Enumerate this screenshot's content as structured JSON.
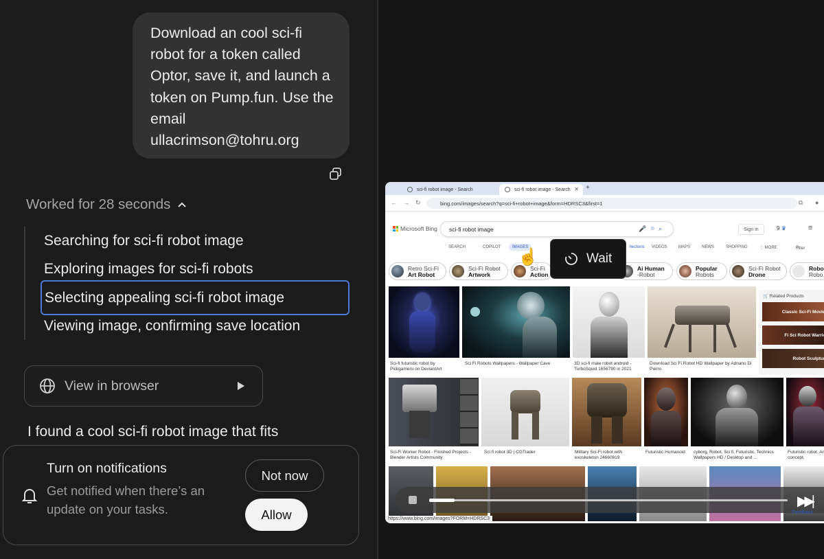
{
  "chat": {
    "user_message": "Download an cool sci-fi robot for a token called Optor, save it, and launch a token on Pump.fun. Use the email ullacrimson@tohru.org",
    "worked_label": "Worked for 28 seconds",
    "steps": [
      "Searching for sci-fi robot image",
      "Exploring images for sci-fi robots",
      "Selecting appealing sci-fi robot image",
      "Viewing image, confirming save location"
    ],
    "view_in_browser": "View in browser",
    "assistant_text": "I found a cool sci-fi robot image that fits"
  },
  "notification": {
    "title": "Turn on notifications",
    "description": "Get notified when there’s an update on your tasks.",
    "not_now": "Not now",
    "allow": "Allow"
  },
  "browser": {
    "tabs": [
      "sci-fi robot image - Search",
      "sci-fi robot image - Search"
    ],
    "url": "bing.com/images/search?q=sci-fi+robot+image&form=HDRSC3&first=1",
    "brand": "Microsoft Bing",
    "search_value": "sci-fi robot image",
    "sign_in": "Sign in",
    "points": "9",
    "nav": [
      "SEARCH",
      "COPILOT",
      "IMAGES",
      "VIDEOS",
      "MAPS",
      "NEWS",
      "SHOPPING",
      "⋮ MORE"
    ],
    "nav_collections": "llections",
    "filter": "Filter",
    "chips": [
      {
        "top": "Retro Sci-Fi",
        "bottom": "Art Robot"
      },
      {
        "top": "Sci-Fi Robot",
        "bottom": "Artwork"
      },
      {
        "top": "Sci-Fi",
        "bottom": "Action"
      },
      {
        "top": "Ai Human",
        "bottom": "-Robot"
      },
      {
        "top": "Popular",
        "bottom": "Robots"
      },
      {
        "top": "Sci-Fi Robot",
        "bottom": "Drone"
      },
      {
        "top": "Robo",
        "bottom": "Robo"
      }
    ],
    "row1_captions": [
      "Sci-fi futuristic robot by Pickgameru on DeviantArt",
      "Sci Fi Robots Wallpapers - Wallpaper Cave",
      "3D sci-fi male robot android - TurboSquid 1656790 in 2021",
      "Download Sci Fi Robot HD Wallpaper by Adriano Di Pierro"
    ],
    "related_title": "Related Products",
    "related": [
      "Classic Sci-Fi Movies",
      "Fi Sci Robot Warrior",
      "Robot Sculpture"
    ],
    "row2_captions": [
      "Sci-Fi Worker Robot - Finished Projects - Blender Artists Community",
      "Sci fi robot 3D | CGTrader",
      "Military Sci-Fi robot with exoskeleton 24660819",
      "Futuristic Humanoid",
      "cyborg, Robot, Sci fi, Futuristic, Technics Wallpapers HD / Desktop and ...",
      "Futuristic robot, Armor concept,"
    ],
    "status_url": "https://www.bing.com/images?FORM=HDRSC3",
    "feedback": "Feedback"
  },
  "overlay": {
    "wait_label": "Wait"
  },
  "player": {
    "progress": 0.07
  },
  "colors": {
    "accent_focus": "#4a7ad8",
    "bing_blue": "#2b5fc9"
  }
}
